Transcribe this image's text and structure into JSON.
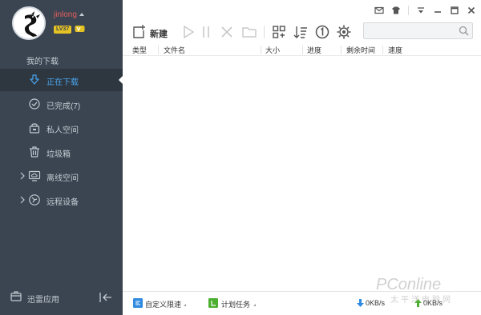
{
  "user": {
    "name": "jinlong",
    "level": "LV37"
  },
  "sidebar": {
    "section_title": "我的下载",
    "items": [
      {
        "label": "正在下载",
        "icon": "download-arrow-icon",
        "active": true
      },
      {
        "label": "已完成(7)",
        "icon": "check-circle-icon"
      },
      {
        "label": "私人空间",
        "icon": "lock-icon"
      },
      {
        "label": "垃圾箱",
        "icon": "trash-icon"
      },
      {
        "label": "离线空间",
        "icon": "cloud-screen-icon",
        "expandable": true
      },
      {
        "label": "远程设备",
        "icon": "remote-device-icon",
        "expandable": true
      }
    ],
    "apps_label": "迅雷应用"
  },
  "toolbar": {
    "new_label": "新建",
    "search": {
      "placeholder": ""
    }
  },
  "table": {
    "columns": [
      "类型",
      "文件名",
      "大小",
      "进度",
      "剩余时间",
      "速度"
    ]
  },
  "statusbar": {
    "speed_limit_label": "自定义限速",
    "schedule_label": "计划任务",
    "download_speed": "0KB/s",
    "upload_speed": "0KB/s"
  },
  "watermark": {
    "main": "PConline",
    "sub": "太平洋电脑网"
  },
  "colors": {
    "sidebar_bg": "#3b4551",
    "active_item_bg": "#2e3640",
    "accent": "#4aa6ef",
    "username": "#e35d5d"
  }
}
